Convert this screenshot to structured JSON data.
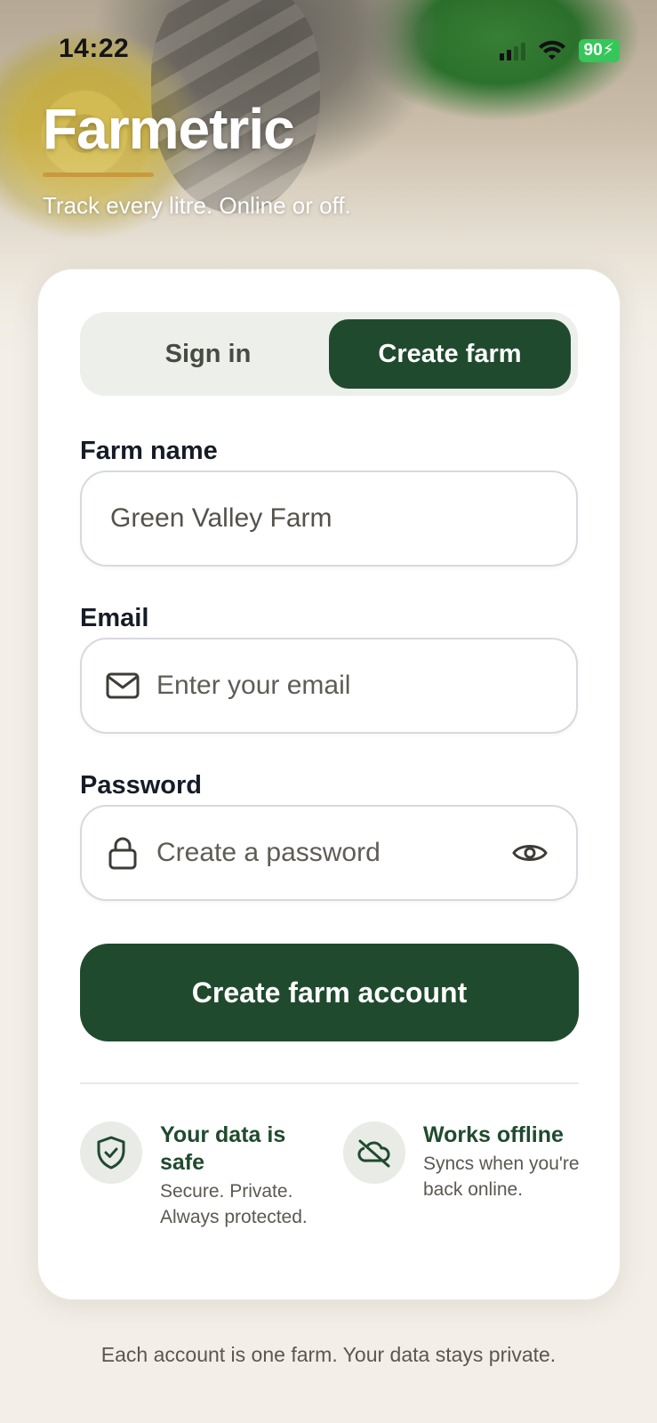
{
  "status_bar": {
    "time": "14:22",
    "battery": "90"
  },
  "brand": {
    "name": "Farmetric",
    "tagline": "Track every litre. Online or off."
  },
  "tabs": [
    {
      "label": "Sign in",
      "active": false
    },
    {
      "label": "Create farm",
      "active": true
    }
  ],
  "form": {
    "farm_name": {
      "label": "Farm name",
      "value": "Green Valley Farm"
    },
    "email": {
      "label": "Email",
      "placeholder": "Enter your email",
      "icon": "mail-icon"
    },
    "password": {
      "label": "Password",
      "placeholder": "Create a password",
      "icon": "lock-icon",
      "toggle_icon": "eye-icon"
    },
    "submit_label": "Create farm account"
  },
  "features": [
    {
      "icon": "shield-check-icon",
      "title": "Your data is safe",
      "desc": "Secure. Private. Always protected."
    },
    {
      "icon": "cloud-off-icon",
      "title": "Works offline",
      "desc": "Syncs when you're back online."
    }
  ],
  "footer": "Each account is one farm. Your data stays private.",
  "colors": {
    "primary": "#204a2e",
    "accent": "#c79a3c",
    "background": "#f3efe8",
    "tab_track": "#ecefea"
  }
}
